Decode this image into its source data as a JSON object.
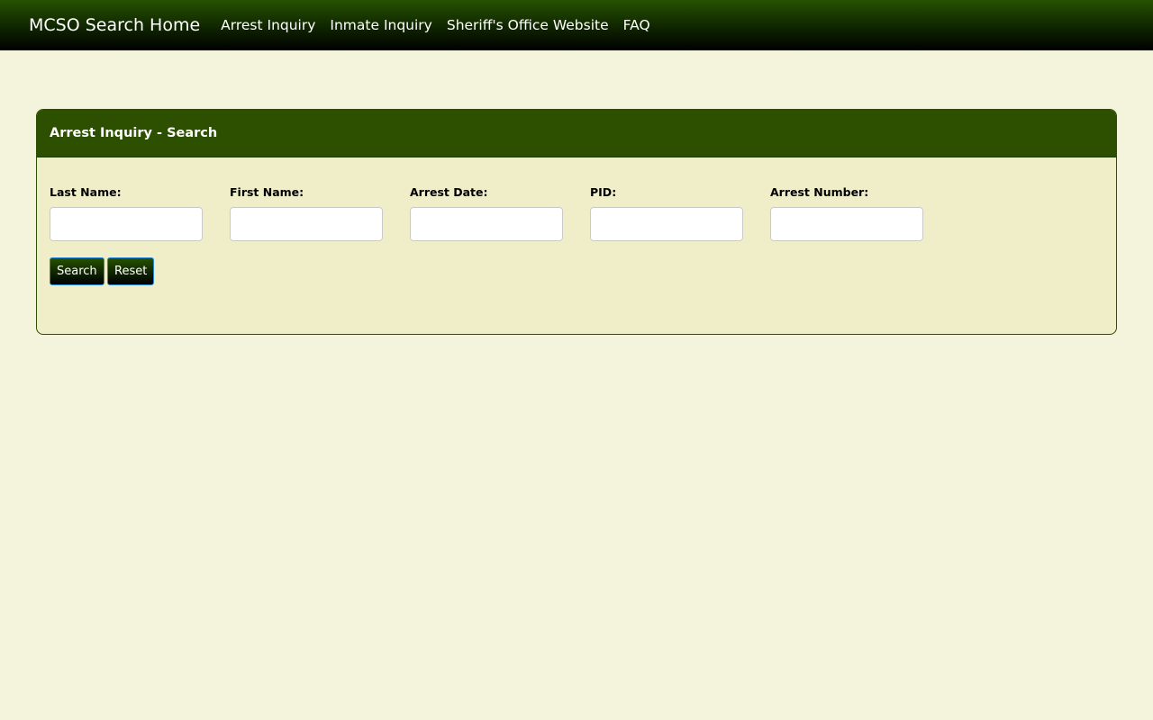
{
  "navbar": {
    "brand": "MCSO Search Home",
    "links": [
      {
        "label": "Arrest Inquiry"
      },
      {
        "label": "Inmate Inquiry"
      },
      {
        "label": "Sheriff's Office Website"
      },
      {
        "label": "FAQ"
      }
    ]
  },
  "panel": {
    "title": "Arrest Inquiry - Search",
    "fields": [
      {
        "label": "Last Name:",
        "value": ""
      },
      {
        "label": "First Name:",
        "value": ""
      },
      {
        "label": "Arrest Date:",
        "value": ""
      },
      {
        "label": "PID:",
        "value": ""
      },
      {
        "label": "Arrest Number:",
        "value": ""
      }
    ],
    "buttons": {
      "search": "Search",
      "reset": "Reset"
    }
  },
  "colors": {
    "page_background": "#f4f3dc",
    "panel_background": "#efeec8",
    "header_green": "#2c5000",
    "navbar_gradient_top": "#265200",
    "navbar_gradient_bottom": "#000000",
    "button_border": "#2a86d6"
  }
}
